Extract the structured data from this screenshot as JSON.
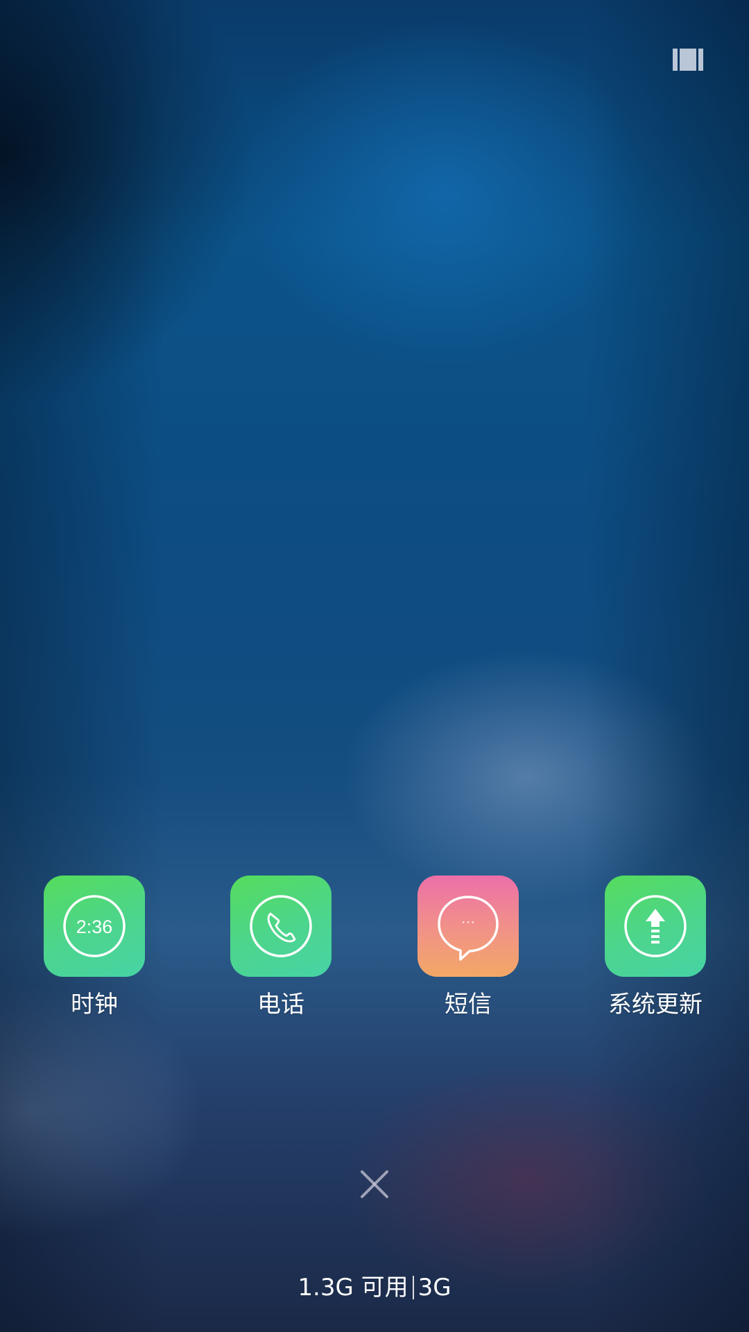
{
  "header": {
    "clear_icon": "multi-window-icon"
  },
  "apps": [
    {
      "label": "时钟",
      "icon": "clock-icon",
      "icon_text": "2:36",
      "color": "#4dd58a"
    },
    {
      "label": "电话",
      "icon": "phone-icon",
      "color": "#4dd58a"
    },
    {
      "label": "短信",
      "icon": "message-icon",
      "icon_text": "···",
      "color": "#f1908a"
    },
    {
      "label": "系统更新",
      "icon": "update-icon",
      "color": "#4dd58a"
    }
  ],
  "footer": {
    "close_icon": "close-icon",
    "memory_available": "1.3G 可用",
    "memory_total": "3G"
  }
}
